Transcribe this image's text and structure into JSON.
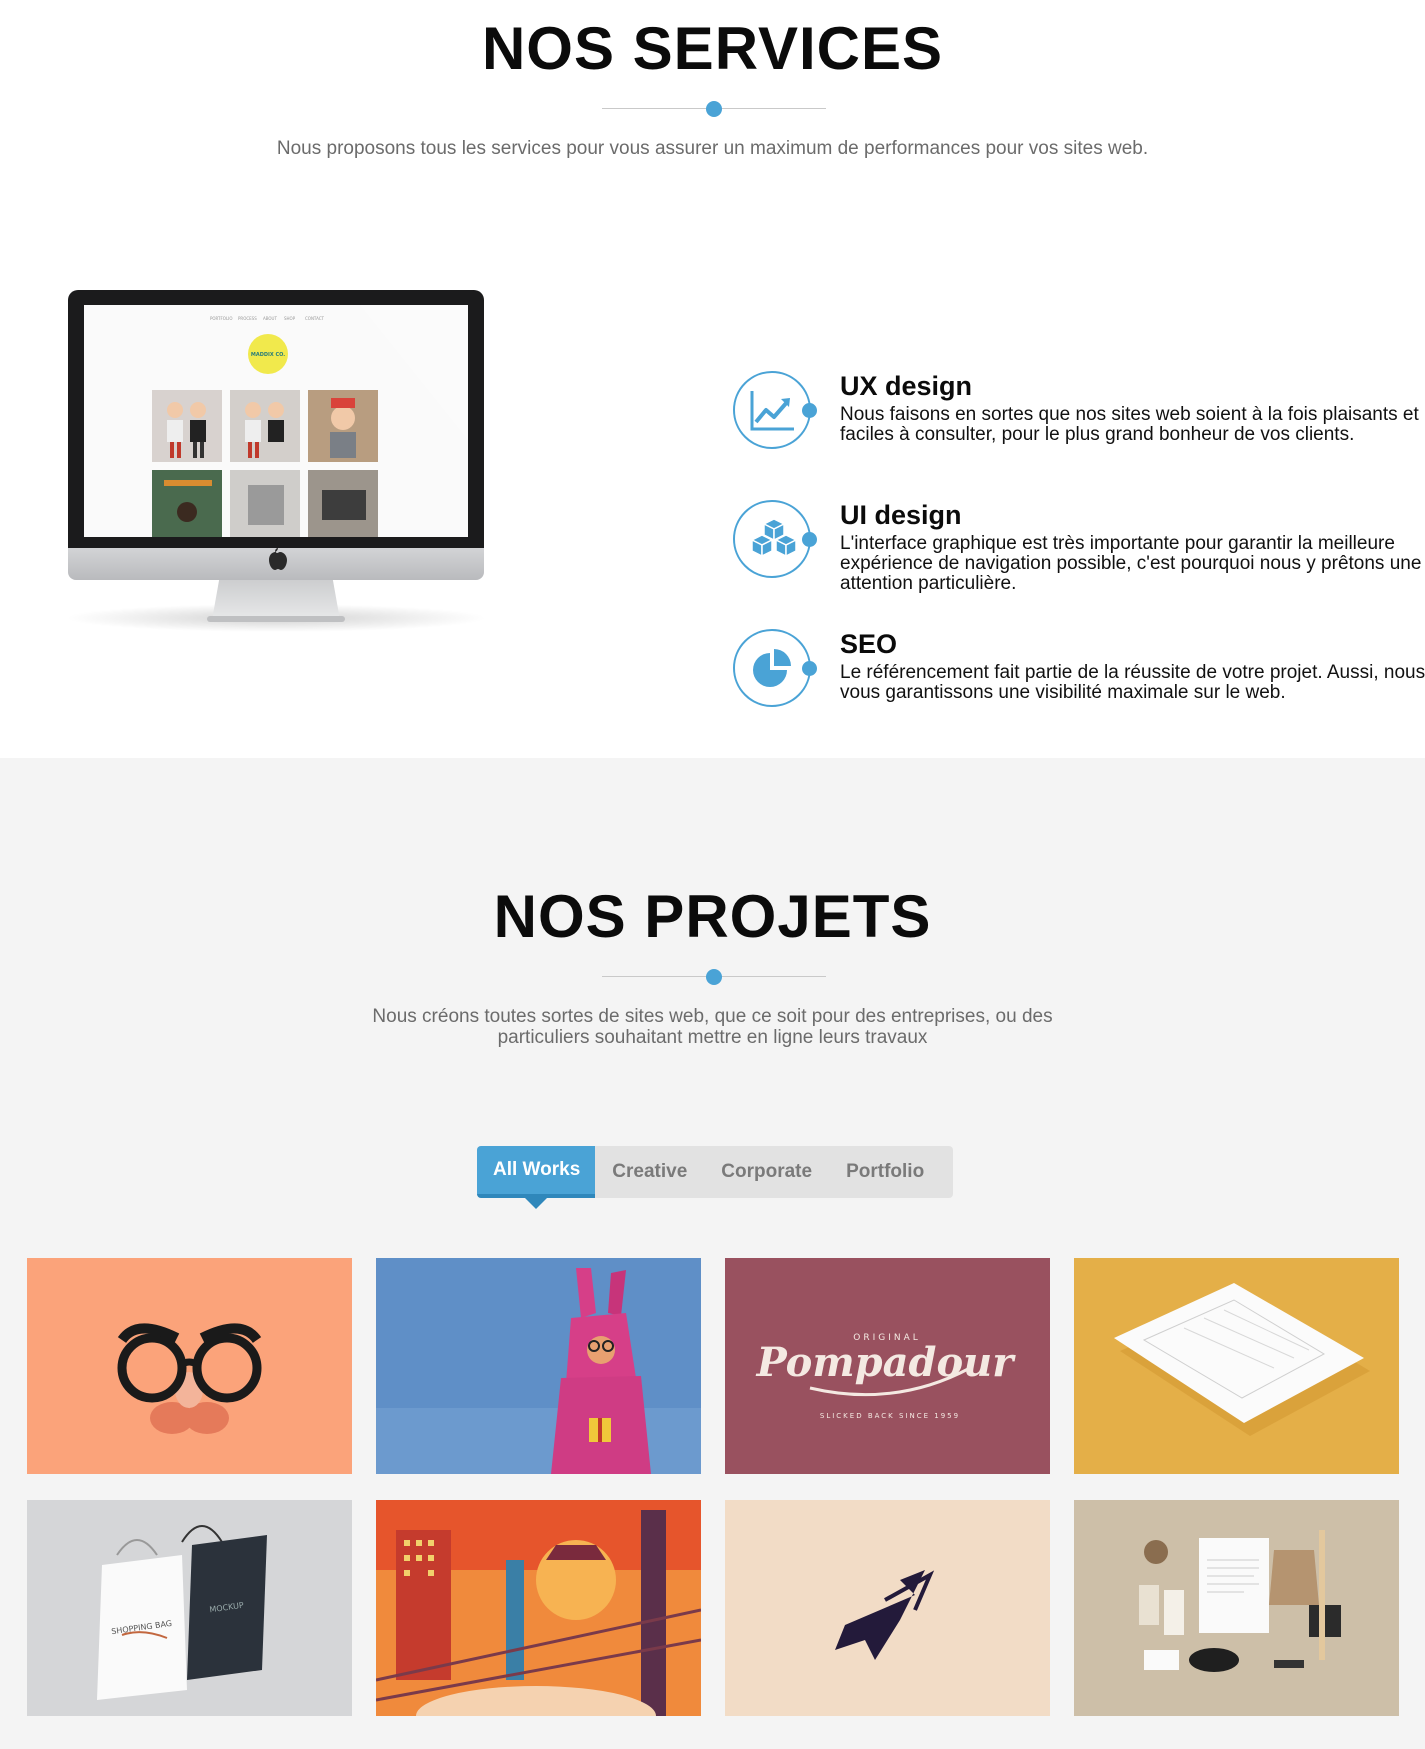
{
  "services": {
    "title": "NOS SERVICES",
    "subtitle": "Nous proposons tous les services pour vous assurer un maximum de performances pour vos sites web.",
    "screen_logo_text": "MADDIX CO.",
    "features": [
      {
        "icon": "chart-line-icon",
        "title": "UX design",
        "text": "Nous faisons en sortes que nos sites web soient à la fois plaisants et faciles à consulter, pour le plus grand bonheur de vos clients."
      },
      {
        "icon": "cubes-icon",
        "title": "UI design",
        "text": "L'interface graphique est très importante pour garantir la meilleure expérience de navigation possible, c'est pourquoi nous y prêtons une attention particulière."
      },
      {
        "icon": "pie-chart-icon",
        "title": "SEO",
        "text": "Le référencement fait partie de la réussite de votre projet. Aussi, nous vous garantissons une visibilité maximale sur le web."
      }
    ]
  },
  "projects": {
    "title": "NOS PROJETS",
    "subtitle_line1": "Nous créons toutes sortes de sites web, que ce soit pour des entreprises, ou des",
    "subtitle_line2": "particuliers souhaitant mettre en ligne leurs travaux",
    "tabs": [
      "All Works",
      "Creative",
      "Corporate",
      "Portfolio"
    ],
    "active_tab": "All Works",
    "items": [
      {
        "name": "glasses-mustache",
        "bg": "#fba37a"
      },
      {
        "name": "pink-rabbit",
        "bg": "#5f8fc7"
      },
      {
        "name": "pompadour-logo",
        "bg": "#99515f",
        "text_brand": "Pompadour",
        "text_top": "ORIGINAL",
        "text_bottom": "SLICKED BACK SINCE 1959"
      },
      {
        "name": "letterhead-paper",
        "bg": "#e4af48"
      },
      {
        "name": "shopping-bags",
        "bg": "#d5d6d8"
      },
      {
        "name": "city-bridge",
        "bg": "#f08a3c"
      },
      {
        "name": "plane-logo",
        "bg": "#f2dcc6"
      },
      {
        "name": "stationery-mockup",
        "bg": "#cdbfa8"
      }
    ]
  },
  "colors": {
    "accent": "#4aa3d6",
    "section_bg": "#f4f4f4"
  }
}
